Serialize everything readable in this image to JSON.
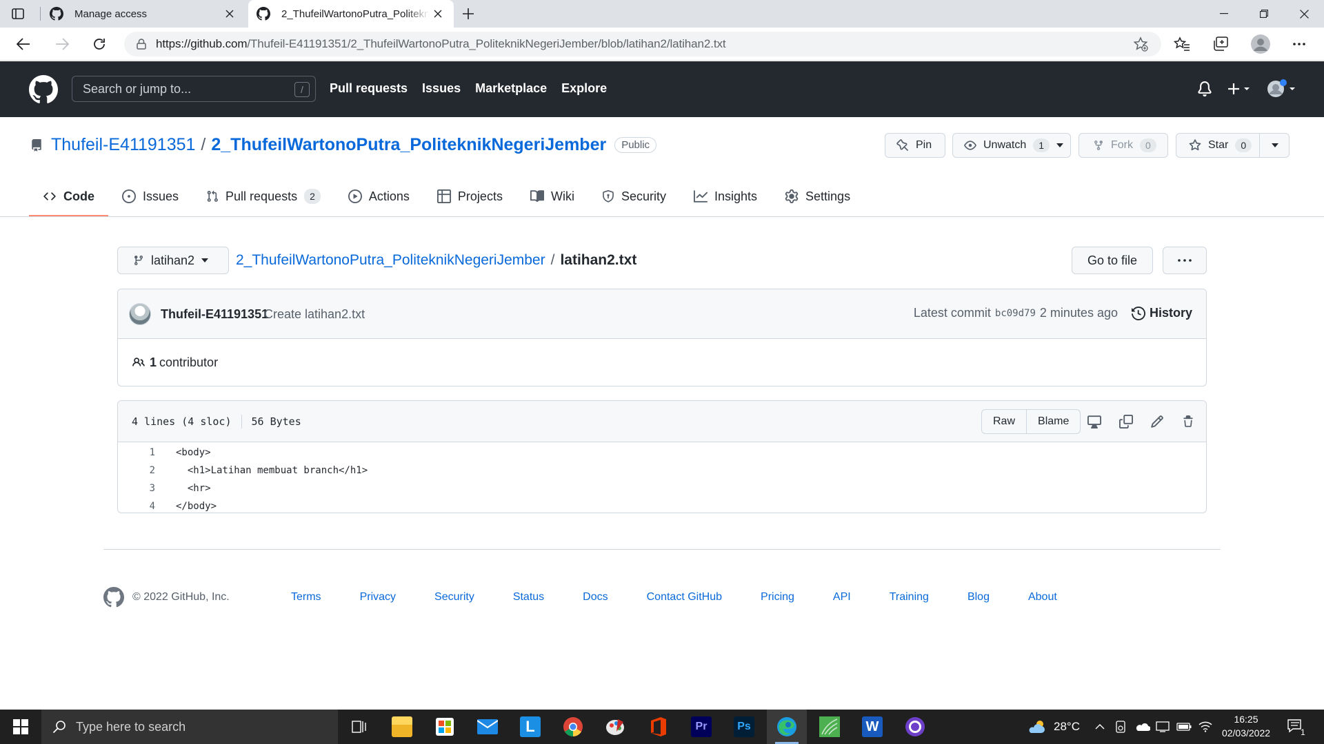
{
  "browser": {
    "tabs": [
      {
        "title": "Manage access"
      },
      {
        "title": "2_ThufeilWartonoPutra_PoliteknikNegeriJember"
      }
    ],
    "url_host": "https://github.com",
    "url_path": "/Thufeil-E41191351/2_ThufeilWartonoPutra_PoliteknikNegeriJember/blob/latihan2/latihan2.txt"
  },
  "gh": {
    "search_placeholder": "Search or jump to...",
    "search_key": "/",
    "nav": [
      "Pull requests",
      "Issues",
      "Marketplace",
      "Explore"
    ]
  },
  "repo": {
    "owner": "Thufeil-E41191351",
    "sep": "/",
    "name": "2_ThufeilWartonoPutra_PoliteknikNegeriJember",
    "visibility": "Public",
    "pin_label": "Pin",
    "watch_label": "Unwatch",
    "watch_count": "1",
    "fork_label": "Fork",
    "fork_count": "0",
    "star_label": "Star",
    "star_count": "0",
    "tabs": [
      {
        "label": "Code",
        "icon": "code-icon"
      },
      {
        "label": "Issues",
        "icon": "issue-icon"
      },
      {
        "label": "Pull requests",
        "icon": "pull-request-icon",
        "count": "2"
      },
      {
        "label": "Actions",
        "icon": "play-icon"
      },
      {
        "label": "Projects",
        "icon": "table-icon"
      },
      {
        "label": "Wiki",
        "icon": "book-icon"
      },
      {
        "label": "Security",
        "icon": "shield-icon"
      },
      {
        "label": "Insights",
        "icon": "graph-icon"
      },
      {
        "label": "Settings",
        "icon": "gear-icon"
      }
    ]
  },
  "file": {
    "branch": "latihan2",
    "crumb_repo": "2_ThufeilWartonoPutra_PoliteknikNegeriJember",
    "crumb_sep": "/",
    "filename": "latihan2.txt",
    "goto_label": "Go to file",
    "commit_author": "Thufeil-E41191351",
    "commit_message": "Create latihan2.txt",
    "latest_commit_label": "Latest commit",
    "commit_sha": "bc09d79",
    "commit_time": "2 minutes ago",
    "history_label": "History",
    "contributors_count": "1",
    "contributors_label": "contributor",
    "lines_info": "4 lines (4 sloc)",
    "size_info": "56 Bytes",
    "raw_label": "Raw",
    "blame_label": "Blame",
    "lines": [
      {
        "n": "1",
        "text": "<body>"
      },
      {
        "n": "2",
        "text": "  <h1>Latihan membuat branch</h1>"
      },
      {
        "n": "3",
        "text": "  <hr>"
      },
      {
        "n": "4",
        "text": "</body>"
      }
    ]
  },
  "footer": {
    "copyright": "© 2022 GitHub, Inc.",
    "links": [
      "Terms",
      "Privacy",
      "Security",
      "Status",
      "Docs",
      "Contact GitHub",
      "Pricing",
      "API",
      "Training",
      "Blog",
      "About"
    ]
  },
  "taskbar": {
    "search_placeholder": "Type here to search",
    "weather": "28°C",
    "time": "16:25",
    "date": "02/03/2022",
    "notification_count": "1"
  },
  "colors": {
    "accent": "#0969da",
    "header_bg": "#24292f",
    "tab_underline": "#fd8c73"
  }
}
